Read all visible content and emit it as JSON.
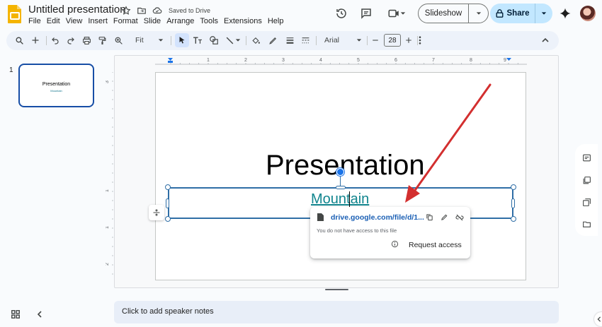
{
  "app": {
    "doc_title": "Untitled presentation",
    "save_status": "Saved to Drive",
    "logo_color": "#f4b400"
  },
  "menu": [
    "File",
    "Edit",
    "View",
    "Insert",
    "Format",
    "Slide",
    "Arrange",
    "Tools",
    "Extensions",
    "Help"
  ],
  "header": {
    "slideshow_label": "Slideshow",
    "share_label": "Share",
    "share_color": "#c2e7ff"
  },
  "toolbar": {
    "zoom": "Fit",
    "font": "Arial",
    "font_size": "28"
  },
  "filmstrip": {
    "slide_number": "1",
    "thumb_title": "Presentation",
    "thumb_subtitle": "Mountain"
  },
  "slide": {
    "title": "Presentation",
    "subtitle_link": "Mountain",
    "link_color": "#11858e"
  },
  "link_popup": {
    "url": "drive.google.com/file/d/1...",
    "note": "You do not have access to this file",
    "request_label": "Request access"
  },
  "rulers": {
    "horizontal": [
      "1",
      "2",
      "3",
      "4",
      "5",
      "6",
      "7",
      "8",
      "9"
    ],
    "vertical": [
      "3",
      "1",
      "1",
      "2"
    ]
  },
  "notes": {
    "placeholder": "Click to add speaker notes"
  },
  "annotation": {
    "arrow_color": "#d32f2f"
  }
}
